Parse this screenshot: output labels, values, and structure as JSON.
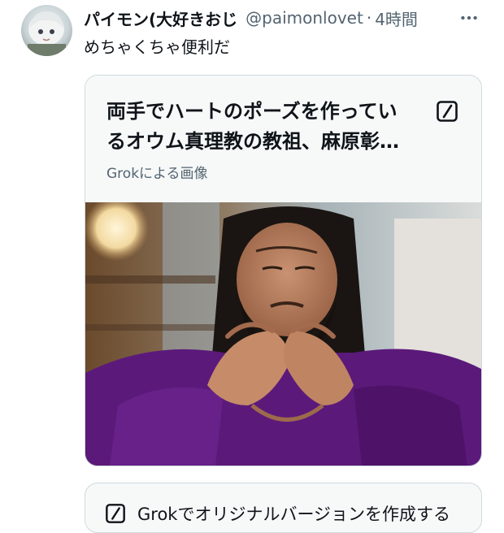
{
  "post": {
    "display_name": "パイモン(大好きおじ",
    "handle": "@paimonlovet",
    "separator": "·",
    "timestamp": "4時間",
    "text": "めちゃくちゃ便利だ"
  },
  "card": {
    "title_line1": "両手でハートのポーズを作ってい",
    "title_line2": "るオウム真理教の教祖、麻原彰…",
    "subtitle": "Grokによる画像"
  },
  "grok_button": {
    "label": "Grokでオリジナルバージョンを作成する"
  },
  "icons": {
    "more": "more-horizontal-icon",
    "edit": "edit-square-icon"
  },
  "colors": {
    "text_primary": "#0f1419",
    "text_secondary": "#536471",
    "border": "#cfd9de",
    "card_bg": "#f7f9f9",
    "robe_purple": "#5b1a7a"
  }
}
